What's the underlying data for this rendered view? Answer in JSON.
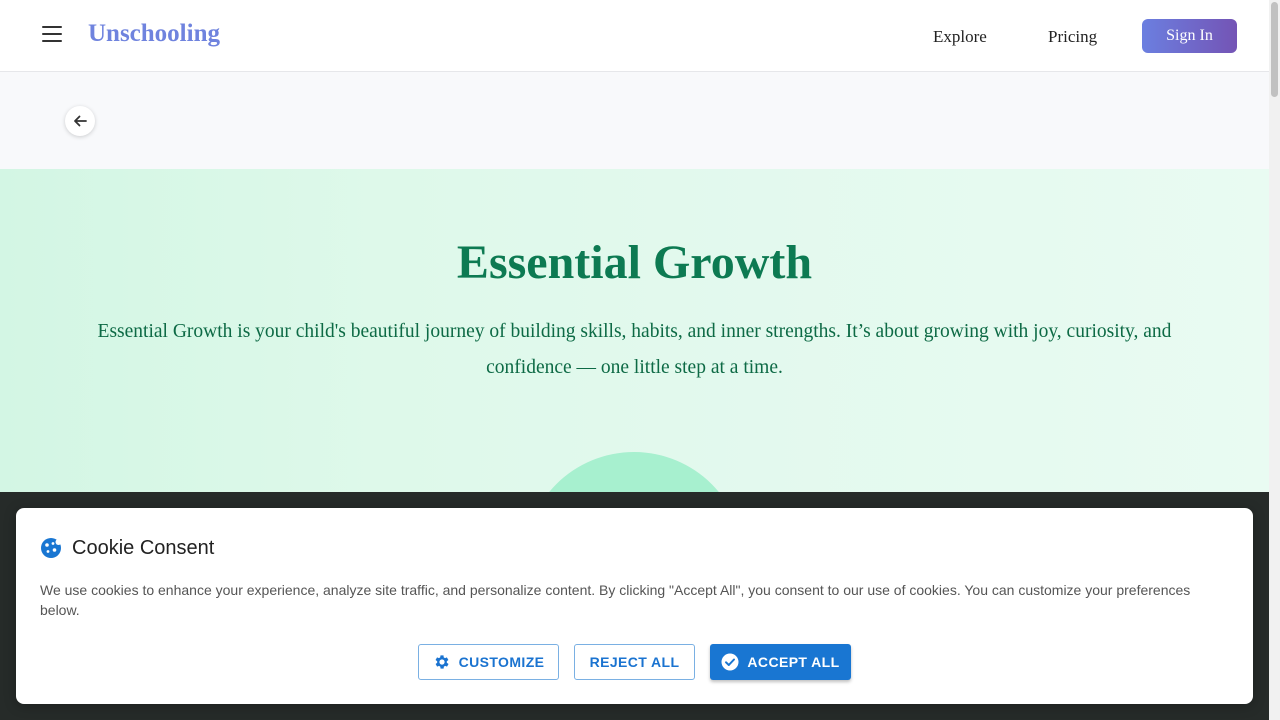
{
  "header": {
    "brand": "Unschooling",
    "nav": {
      "explore": "Explore",
      "pricing": "Pricing"
    },
    "signin": "Sign In"
  },
  "hero": {
    "title": "Essential Growth",
    "description": "Essential Growth is your child's beautiful journey of building skills, habits, and inner strengths. It’s about growing with joy, curiosity, and confidence — one little step at a time."
  },
  "cookie": {
    "title": "Cookie Consent",
    "text": "We use cookies to enhance your experience, analyze site traffic, and personalize content. By clicking \"Accept All\", you consent to our use of cookies. You can customize your preferences below.",
    "buttons": {
      "customize": "CUSTOMIZE",
      "reject": "REJECT ALL",
      "accept": "ACCEPT ALL"
    }
  },
  "icons": {
    "menu": "hamburger-icon",
    "back": "arrow-left-icon",
    "cookie": "cookie-icon",
    "customize": "gear-icon",
    "accept": "check-circle-icon"
  },
  "colors": {
    "brand": "#6f83de",
    "hero_title": "#0d7a52",
    "primary": "#1976d2",
    "signin_gradient_end": "#7454b5"
  }
}
